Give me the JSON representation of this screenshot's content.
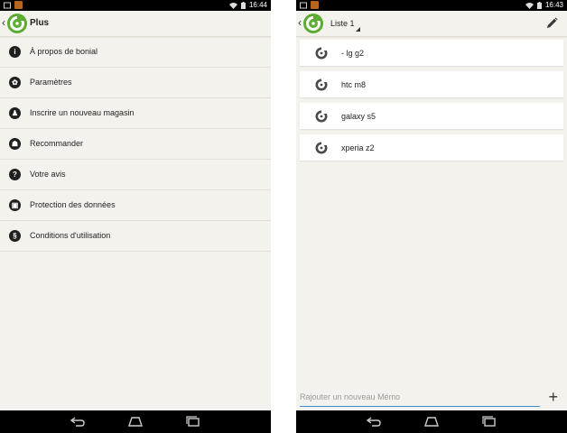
{
  "left_screen": {
    "status": {
      "time": "16:44"
    },
    "title": "Plus",
    "menu_items": [
      {
        "label": "À propos de bonial",
        "icon": "info-icon"
      },
      {
        "label": "Paramètres",
        "icon": "gear-icon"
      },
      {
        "label": "Inscrire un nouveau magasin",
        "icon": "store-icon"
      },
      {
        "label": "Recommander",
        "icon": "recommend-icon"
      },
      {
        "label": "Votre avis",
        "icon": "question-icon"
      },
      {
        "label": "Protection des données",
        "icon": "lock-icon"
      },
      {
        "label": "Conditions d'utilisation",
        "icon": "dollar-icon"
      }
    ]
  },
  "right_screen": {
    "status": {
      "time": "16:43"
    },
    "list_title": "Liste 1",
    "memos": [
      {
        "label": "- lg g2"
      },
      {
        "label": "htc m8"
      },
      {
        "label": "galaxy s5"
      },
      {
        "label": "xperia z2"
      }
    ],
    "memo_input": {
      "placeholder": "Rajouter un nouveau Mémo",
      "value": ""
    }
  },
  "colors": {
    "brand_green": "#5cab33",
    "background": "#f4f2ed",
    "input_underline": "#3b8fd6"
  }
}
